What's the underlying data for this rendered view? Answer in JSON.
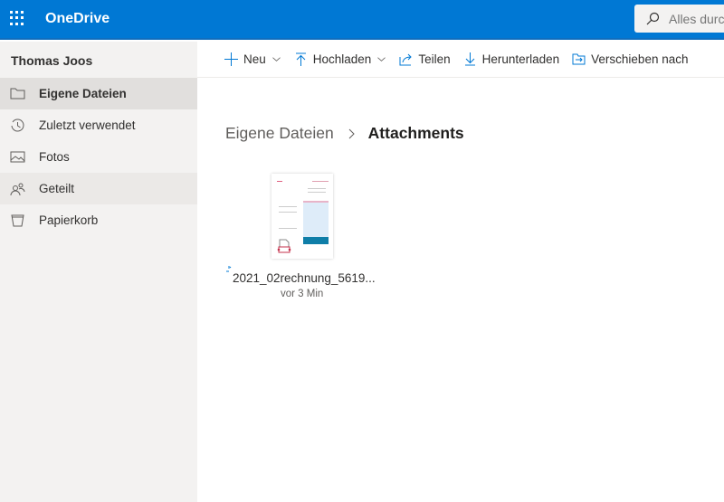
{
  "header": {
    "app_name": "OneDrive",
    "search_placeholder": "Alles durc"
  },
  "sidebar": {
    "user": "Thomas Joos",
    "items": [
      {
        "label": "Eigene Dateien",
        "icon": "folder-icon"
      },
      {
        "label": "Zuletzt verwendet",
        "icon": "history-icon"
      },
      {
        "label": "Fotos",
        "icon": "image-icon"
      },
      {
        "label": "Geteilt",
        "icon": "people-icon"
      },
      {
        "label": "Papierkorb",
        "icon": "recycle-bin-icon"
      }
    ]
  },
  "toolbar": {
    "new": "Neu",
    "upload": "Hochladen",
    "share": "Teilen",
    "download": "Herunterladen",
    "move": "Verschieben nach"
  },
  "breadcrumb": {
    "parent": "Eigene Dateien",
    "current": "Attachments"
  },
  "files": [
    {
      "name": "2021_02rechnung_5619...",
      "modified": "vor 3 Min"
    }
  ],
  "colors": {
    "brand": "#0078d4",
    "sidebar": "#f3f2f1"
  }
}
